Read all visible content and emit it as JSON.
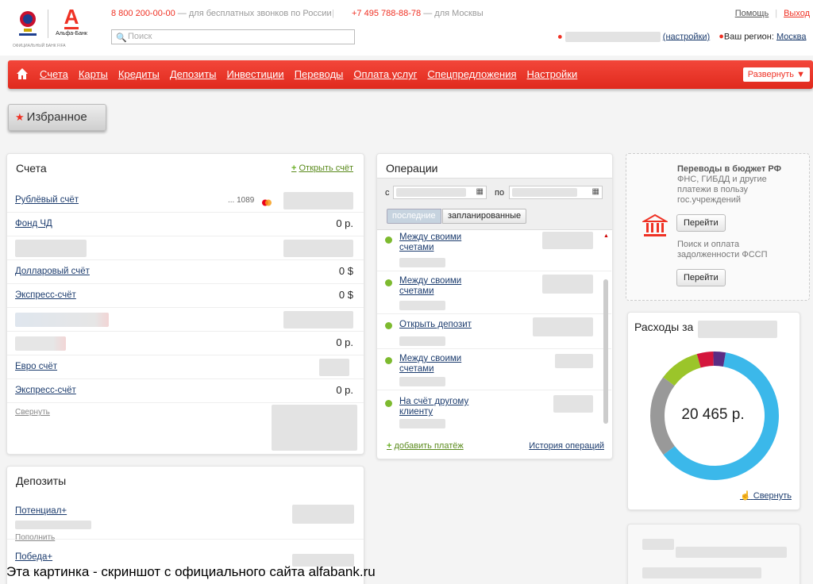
{
  "header": {
    "phone_free": "8 800 200-00-00",
    "phone_free_note": "— для бесплатных звонков по России",
    "phone_moscow": "+7 495 788-88-78",
    "phone_moscow_note": "— для Москвы",
    "help": "Помощь",
    "exit": "Выход",
    "search_placeholder": "Поиск",
    "settings_link": "(настройки)",
    "region_label": "Ваш регион:",
    "region_value": "Москва",
    "logo_name": "Альфа-Банк",
    "logo_sub": "ОФИЦИАЛЬНЫЙ БАНК FIFA"
  },
  "nav": {
    "items": [
      "Счета",
      "Карты",
      "Кредиты",
      "Депозиты",
      "Инвестиции",
      "Переводы",
      "Оплата услуг",
      "Спецпредложения",
      "Настройки"
    ],
    "expand": "Развернуть ▼"
  },
  "favorites": "Избранное",
  "accounts": {
    "title": "Счета",
    "open_link": "Открыть счёт",
    "rows": [
      {
        "name": "Рублёвый счёт",
        "card": "... 1089",
        "value": ""
      },
      {
        "name": "Фонд ЧД",
        "value": "0 р."
      },
      {
        "name": "",
        "value": ""
      },
      {
        "name": "Долларовый счёт",
        "value": "0 $"
      },
      {
        "name": "Экспресс-счёт",
        "value": "0 $"
      },
      {
        "name": "",
        "value": ""
      },
      {
        "name": "",
        "value": "0 р."
      },
      {
        "name": "Евро счёт",
        "value": ""
      },
      {
        "name": "Экспресс-счёт",
        "value": "0 р."
      }
    ],
    "collapse": "Свернуть"
  },
  "deposits": {
    "title": "Депозиты",
    "items": [
      {
        "name": "Потенциал+",
        "action": "Пополнить"
      },
      {
        "name": "Победа+"
      }
    ]
  },
  "operations": {
    "title": "Операции",
    "from_label": "с",
    "to_label": "по",
    "tabs": [
      "последние",
      "запланированные"
    ],
    "items": [
      {
        "name": "Между своими счетами"
      },
      {
        "name": "Между своими счетами"
      },
      {
        "name": "Открыть депозит"
      },
      {
        "name": "Между своими счетами"
      },
      {
        "name": "На счёт другому клиенту"
      }
    ],
    "add_payment": "добавить платёж",
    "history": "История операций"
  },
  "budget": {
    "title": "Переводы в бюджет РФ",
    "desc": "ФНС, ГИБДД и другие платежи в пользу гос.учреждений",
    "btn1": "Перейти",
    "fssp": "Поиск и оплата задолженности ФССП",
    "btn2": "Перейти"
  },
  "expenses": {
    "title": "Расходы за",
    "total": "20 465 р.",
    "collapse": "Свернуть"
  },
  "caption": "Эта картинка - скриншот с официального сайта alfabank.ru",
  "chart_data": {
    "type": "pie",
    "values": [
      60,
      20,
      10,
      4,
      3
    ],
    "colors": [
      "#3bb8ea",
      "#999999",
      "#9bc52a",
      "#d4163c",
      "#5b2c83"
    ]
  }
}
